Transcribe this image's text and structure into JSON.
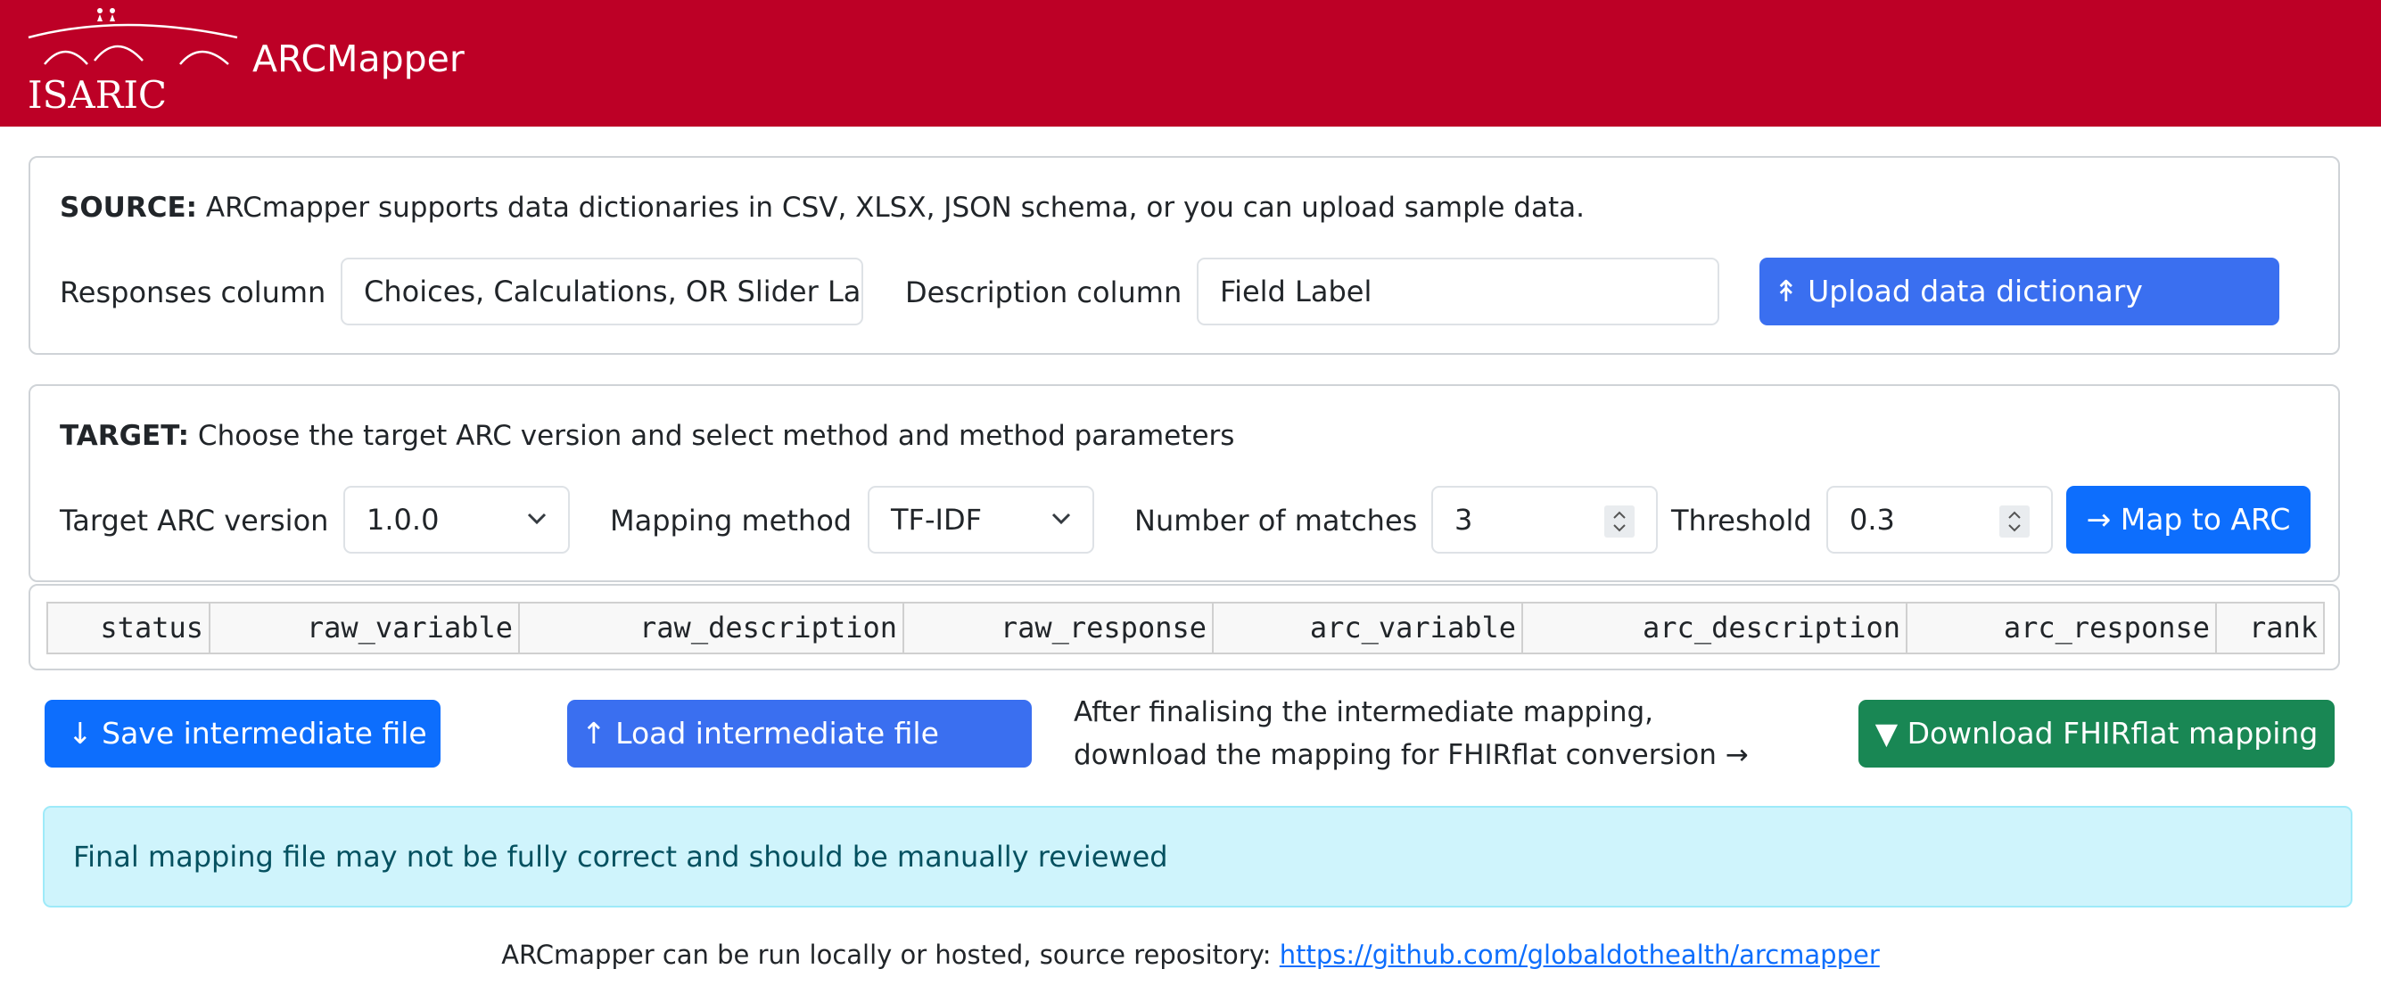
{
  "navbar": {
    "logo_text": "ISARIC",
    "app_title": "ARCMapper",
    "bg_color": "#bd0026"
  },
  "source": {
    "heading_bold": "SOURCE:",
    "heading_text": " ARCmapper supports data dictionaries in CSV, XLSX, JSON schema, or you can upload sample data.",
    "responses_label": "Responses column",
    "responses_value": "Choices, Calculations, OR Slider Labels",
    "description_label": "Description column",
    "description_value": "Field Label",
    "upload_button": "↟ Upload data dictionary"
  },
  "target": {
    "heading_bold": "TARGET:",
    "heading_text": " Choose the target ARC version and select method and method parameters",
    "arc_version_label": "Target ARC version",
    "arc_version_value": "1.0.0",
    "method_label": "Mapping method",
    "method_value": "TF-IDF",
    "matches_label": "Number of matches",
    "matches_value": "3",
    "threshold_label": "Threshold",
    "threshold_value": "0.3",
    "map_button": "→ Map to ARC"
  },
  "table": {
    "columns": [
      "status",
      "raw_variable",
      "raw_description",
      "raw_response",
      "arc_variable",
      "arc_description",
      "arc_response",
      "rank"
    ]
  },
  "actions": {
    "save_button": "↓ Save intermediate file",
    "load_button": "↑ Load intermediate file",
    "note_line1": "After finalising the intermediate mapping,",
    "note_line2": "download the mapping for FHIRflat conversion →",
    "download_button": "▼ Download FHIRflat mapping"
  },
  "alert": {
    "text": "Final mapping file may not be fully correct and should be manually reviewed"
  },
  "footer": {
    "text": "ARCmapper can be run locally or hosted, source repository: ",
    "link": "https://github.com/globaldothealth/arcmapper"
  },
  "colors": {
    "primary": "#0d6efd",
    "upload": "#3a6ff0",
    "success": "#198754",
    "alert_bg": "#cff4fc"
  }
}
